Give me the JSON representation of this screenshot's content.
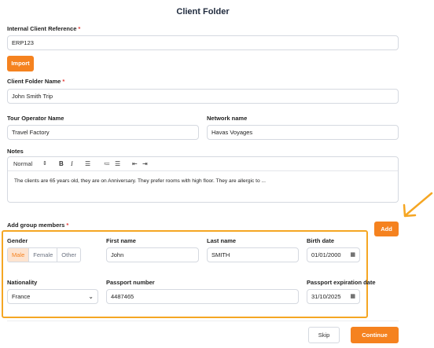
{
  "page": {
    "title": "Client Folder"
  },
  "reference": {
    "label": "Internal Client Reference",
    "value": "ERP123",
    "import_label": "Import"
  },
  "folder_name": {
    "label": "Client Folder Name",
    "value": "John Smith Trip"
  },
  "tour_operator": {
    "label": "Tour Operator Name",
    "value": "Travel Factory"
  },
  "network": {
    "label": "Network name",
    "value": "Havas Voyages"
  },
  "notes": {
    "label": "Notes",
    "style_select": "Normal",
    "content": "The clients are 65 years old, they are on Anniversary. They prefer rooms with high floor. They are allergic to ..."
  },
  "group": {
    "label": "Add group members",
    "add_label": "Add",
    "gender": {
      "label": "Gender",
      "options": [
        "Male",
        "Female",
        "Other"
      ],
      "selected": "Male"
    },
    "first_name": {
      "label": "First name",
      "value": "John"
    },
    "last_name": {
      "label": "Last name",
      "value": "SMITH"
    },
    "birth_date": {
      "label": "Birth date",
      "value": "01/01/2000"
    },
    "nationality": {
      "label": "Nationality",
      "value": "France"
    },
    "passport_number": {
      "label": "Passport number",
      "value": "4487465"
    },
    "passport_expiration": {
      "label": "Passport expiration date",
      "value": "31/10/2025"
    }
  },
  "footer": {
    "skip_label": "Skip",
    "continue_label": "Continue"
  },
  "colors": {
    "accent": "#f5821f",
    "highlight_border": "#f5a623"
  },
  "icons": [
    "chevron-updown-icon",
    "bold-icon",
    "italic-icon",
    "align-icon",
    "ordered-list-icon",
    "bullet-list-icon",
    "indent-icon",
    "outdent-icon",
    "calendar-icon",
    "chevron-down-icon",
    "arrow-annotation-icon"
  ]
}
